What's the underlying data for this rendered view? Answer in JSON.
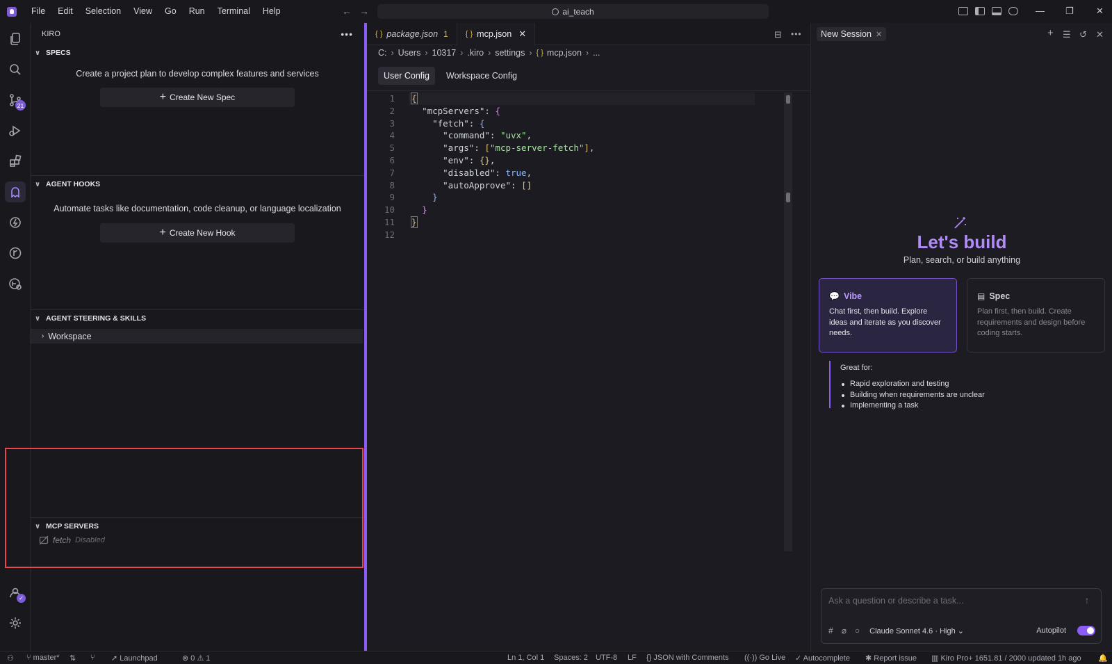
{
  "titlebar": {
    "menu": [
      "File",
      "Edit",
      "Selection",
      "View",
      "Go",
      "Run",
      "Terminal",
      "Help"
    ],
    "search": "ai_teach"
  },
  "activity": {
    "source_control_badge": "21"
  },
  "sidebar": {
    "title": "KIRO",
    "specs": {
      "header": "SPECS",
      "description": "Create a project plan to develop complex features and services",
      "button": "Create New Spec"
    },
    "hooks": {
      "header": "AGENT HOOKS",
      "description": "Automate tasks like documentation, code cleanup, or language localization",
      "button": "Create New Hook"
    },
    "steering": {
      "header": "AGENT STEERING & SKILLS",
      "workspace": "Workspace"
    },
    "mcp": {
      "header": "MCP SERVERS",
      "server_name": "fetch",
      "server_state": "Disabled"
    }
  },
  "editor": {
    "tabs": [
      {
        "label": "package.json",
        "modified_count": "1"
      },
      {
        "label": "mcp.json"
      }
    ],
    "breadcrumb": [
      "C:",
      "Users",
      "10317",
      ".kiro",
      "settings",
      "mcp.json",
      "..."
    ],
    "config_tabs": [
      "User Config",
      "Workspace Config"
    ],
    "line_numbers": [
      "1",
      "2",
      "3",
      "4",
      "5",
      "6",
      "7",
      "8",
      "9",
      "10",
      "11",
      "12"
    ]
  },
  "chat": {
    "session_tab": "New Session",
    "title": "Let's build",
    "subtitle": "Plan, search, or build anything",
    "vibe": {
      "title": "Vibe",
      "desc": "Chat first, then build. Explore ideas and iterate as you discover needs."
    },
    "spec": {
      "title": "Spec",
      "desc": "Plan first, then build. Create requirements and design before coding starts."
    },
    "great_for": {
      "title": "Great for:",
      "items": [
        "Rapid exploration and testing",
        "Building when requirements are unclear",
        "Implementing a task"
      ]
    },
    "input_placeholder": "Ask a question or describe a task...",
    "model": "Claude Sonnet 4.6 · High",
    "autopilot": "Autopilot"
  },
  "status": {
    "branch": "master*",
    "launchpad": "Launchpad",
    "errors": "0",
    "warnings": "1",
    "position": "Ln 1, Col 1",
    "spaces": "Spaces: 2",
    "encoding": "UTF-8",
    "eol": "LF",
    "language": "JSON with Comments",
    "golive": "Go Live",
    "autocomplete": "Autocomplete",
    "report": "Report issue",
    "plan": "Kiro Pro+ 1651.81 / 2000 updated 1h ago"
  },
  "colors": {
    "accent": "#8b5cf6",
    "highlight_box": "#e5484d"
  }
}
